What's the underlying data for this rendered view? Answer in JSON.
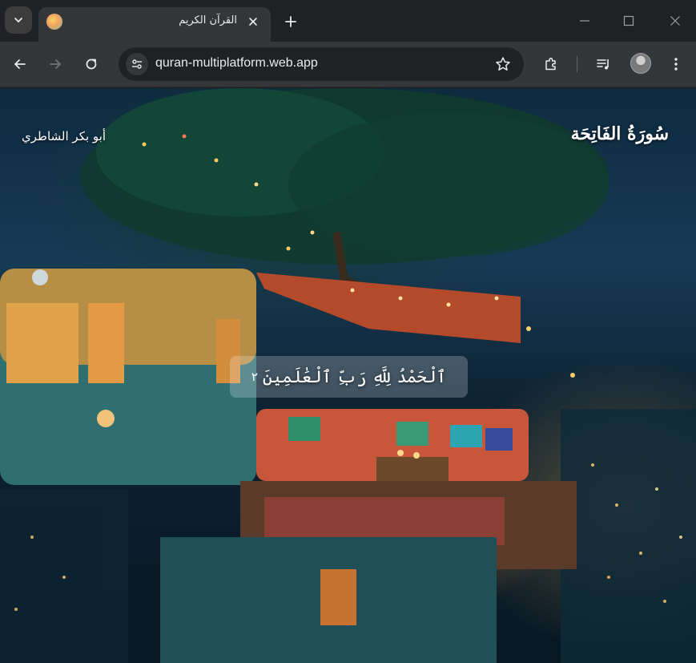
{
  "browser": {
    "tab_title": "القرآن الكريم",
    "url": "quran-multiplatform.web.app",
    "new_tab_symbol": "+",
    "close_symbol": "✕"
  },
  "player": {
    "reciter": "أبو بكر الشاطري",
    "surah_title": "سُورَةُ الفَاتِحَة",
    "verse_text": "ٱلْحَمْدُ لِلَّهِ رَبِّ ٱلْعَٰلَمِينَ",
    "verse_number": "٢"
  },
  "colors": {
    "chrome_dark": "#202124",
    "chrome_toolbar": "#35363a",
    "chrome_text": "#e8eaed",
    "verse_overlay": "rgba(255,255,255,0.22)"
  }
}
